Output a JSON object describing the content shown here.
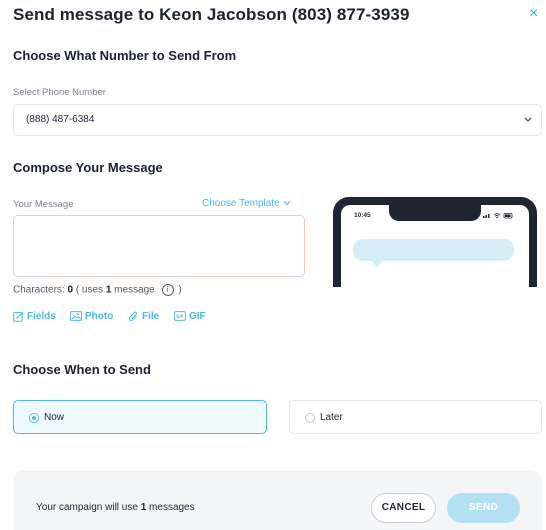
{
  "modal": {
    "title": "Send message to Keon Jacobson (803) 877-3939",
    "close_icon": "×"
  },
  "from_section": {
    "heading": "Choose What Number to Send From",
    "select_label": "Select Phone Number",
    "selected_number": "(888) 487-6384"
  },
  "compose": {
    "heading": "Compose Your Message",
    "message_label": "Your Message",
    "template_link": "Choose Template",
    "message_value": "",
    "characters_prefix": "Characters:",
    "characters_count": "0",
    "uses_prefix": "( uses",
    "uses_count": "1",
    "uses_suffix": "message",
    "info_icon": "i",
    "close_paren": ")",
    "tools": {
      "fields": "Fields",
      "photo": "Photo",
      "file": "File",
      "gif": "GIF"
    },
    "phone_preview": {
      "time": "10:45"
    }
  },
  "when_section": {
    "heading": "Choose When to Send",
    "now_label": "Now",
    "later_label": "Later",
    "selected": "now"
  },
  "footer": {
    "usage_prefix": "Your campaign will use",
    "usage_count": "1",
    "usage_suffix": "messages",
    "cancel_label": "CANCEL",
    "send_label": "SEND"
  },
  "colors": {
    "accent": "#4fb7e3",
    "send_disabled": "#b3e1f3",
    "textarea_border": "#f3c9c9"
  }
}
